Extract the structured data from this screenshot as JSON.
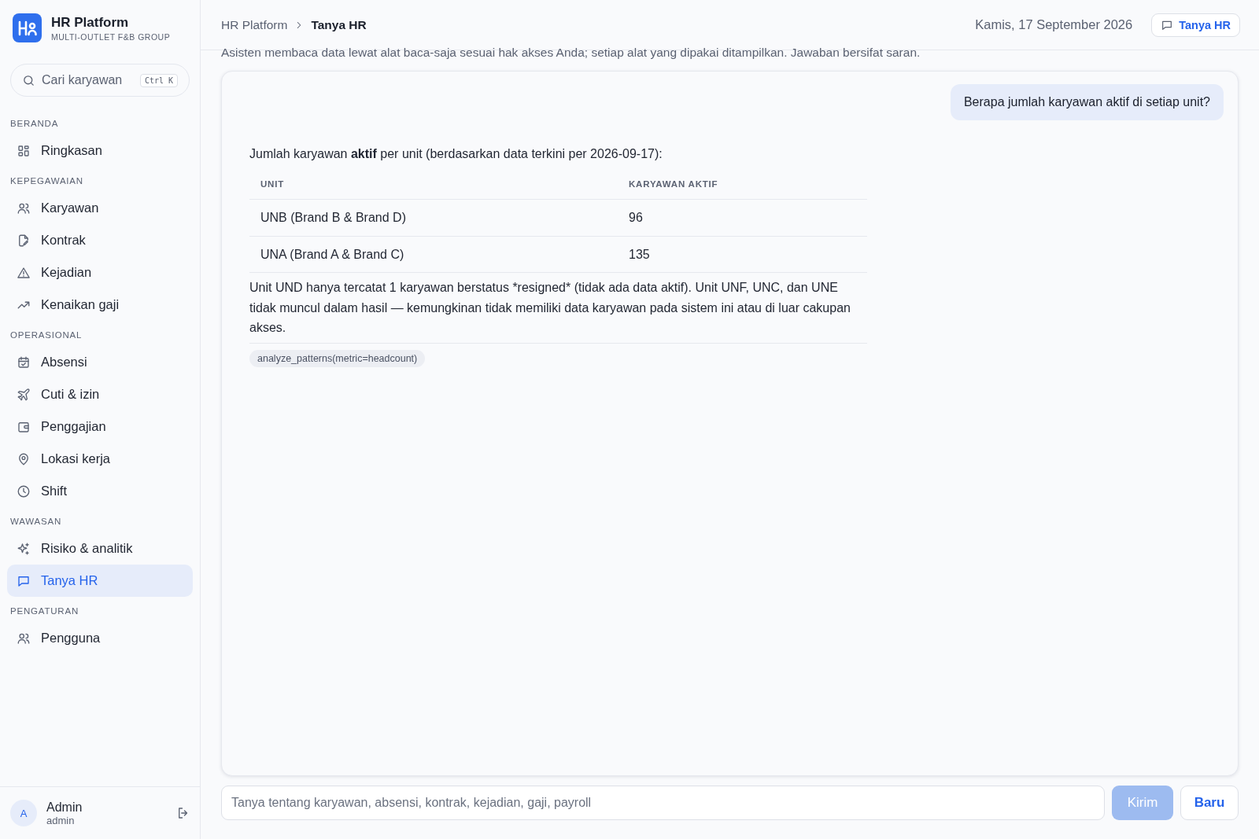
{
  "brand": {
    "name": "HR Platform",
    "tagline": "MULTI-OUTLET F&B GROUP"
  },
  "search": {
    "placeholder": "Cari karyawan",
    "shortcut": "Ctrl K"
  },
  "sidebar": {
    "sections": [
      {
        "title": "BERANDA",
        "items": [
          {
            "label": "Ringkasan",
            "selected": false
          }
        ]
      },
      {
        "title": "KEPEGAWAIAN",
        "items": [
          {
            "label": "Karyawan",
            "selected": false
          },
          {
            "label": "Kontrak",
            "selected": false
          },
          {
            "label": "Kejadian",
            "selected": false
          },
          {
            "label": "Kenaikan gaji",
            "selected": false
          }
        ]
      },
      {
        "title": "OPERASIONAL",
        "items": [
          {
            "label": "Absensi",
            "selected": false
          },
          {
            "label": "Cuti & izin",
            "selected": false
          },
          {
            "label": "Penggajian",
            "selected": false
          },
          {
            "label": "Lokasi kerja",
            "selected": false
          },
          {
            "label": "Shift",
            "selected": false
          }
        ]
      },
      {
        "title": "WAWASAN",
        "items": [
          {
            "label": "Risiko & analitik",
            "selected": false
          },
          {
            "label": "Tanya HR",
            "selected": true
          }
        ]
      },
      {
        "title": "PENGATURAN",
        "items": [
          {
            "label": "Pengguna",
            "selected": false
          }
        ]
      }
    ]
  },
  "user": {
    "initial": "A",
    "name": "Admin",
    "role": "admin"
  },
  "breadcrumb": [
    "HR Platform",
    "Tanya HR"
  ],
  "header": {
    "date": "Kamis, 17 September 2026",
    "button": "Tanya HR"
  },
  "subtitle": "Asisten membaca data lewat alat baca-saja sesuai hak akses Anda; setiap alat yang dipakai ditampilkan. Jawaban bersifat saran.",
  "chat": {
    "user_message": "Berapa jumlah karyawan aktif di setiap unit?",
    "answer": {
      "intro": "Jumlah karyawan **aktif** per unit (berdasarkan data terkini per 2026-09-17):",
      "table": {
        "columns": [
          "UNIT",
          "KARYAWAN AKTIF"
        ],
        "rows": [
          [
            "UNB (Brand B & Brand D)",
            "96"
          ],
          [
            "UNA (Brand A & Brand C)",
            "135"
          ]
        ]
      },
      "note": "Unit UND hanya tercatat 1 karyawan berstatus *resigned* (tidak ada data aktif). Unit UNF, UNC, dan UNE tidak muncul dalam hasil — kemungkinan tidak memiliki data karyawan pada sistem ini atau di luar cakupan akses.",
      "tools": [
        "analyze_patterns(metric=headcount)"
      ]
    }
  },
  "composer": {
    "placeholder": "Tanya tentang karyawan, absensi, kontrak, kejadian, gaji, payroll",
    "send": {
      "label": "Kirim",
      "disabled": true
    },
    "new": "Baru"
  }
}
